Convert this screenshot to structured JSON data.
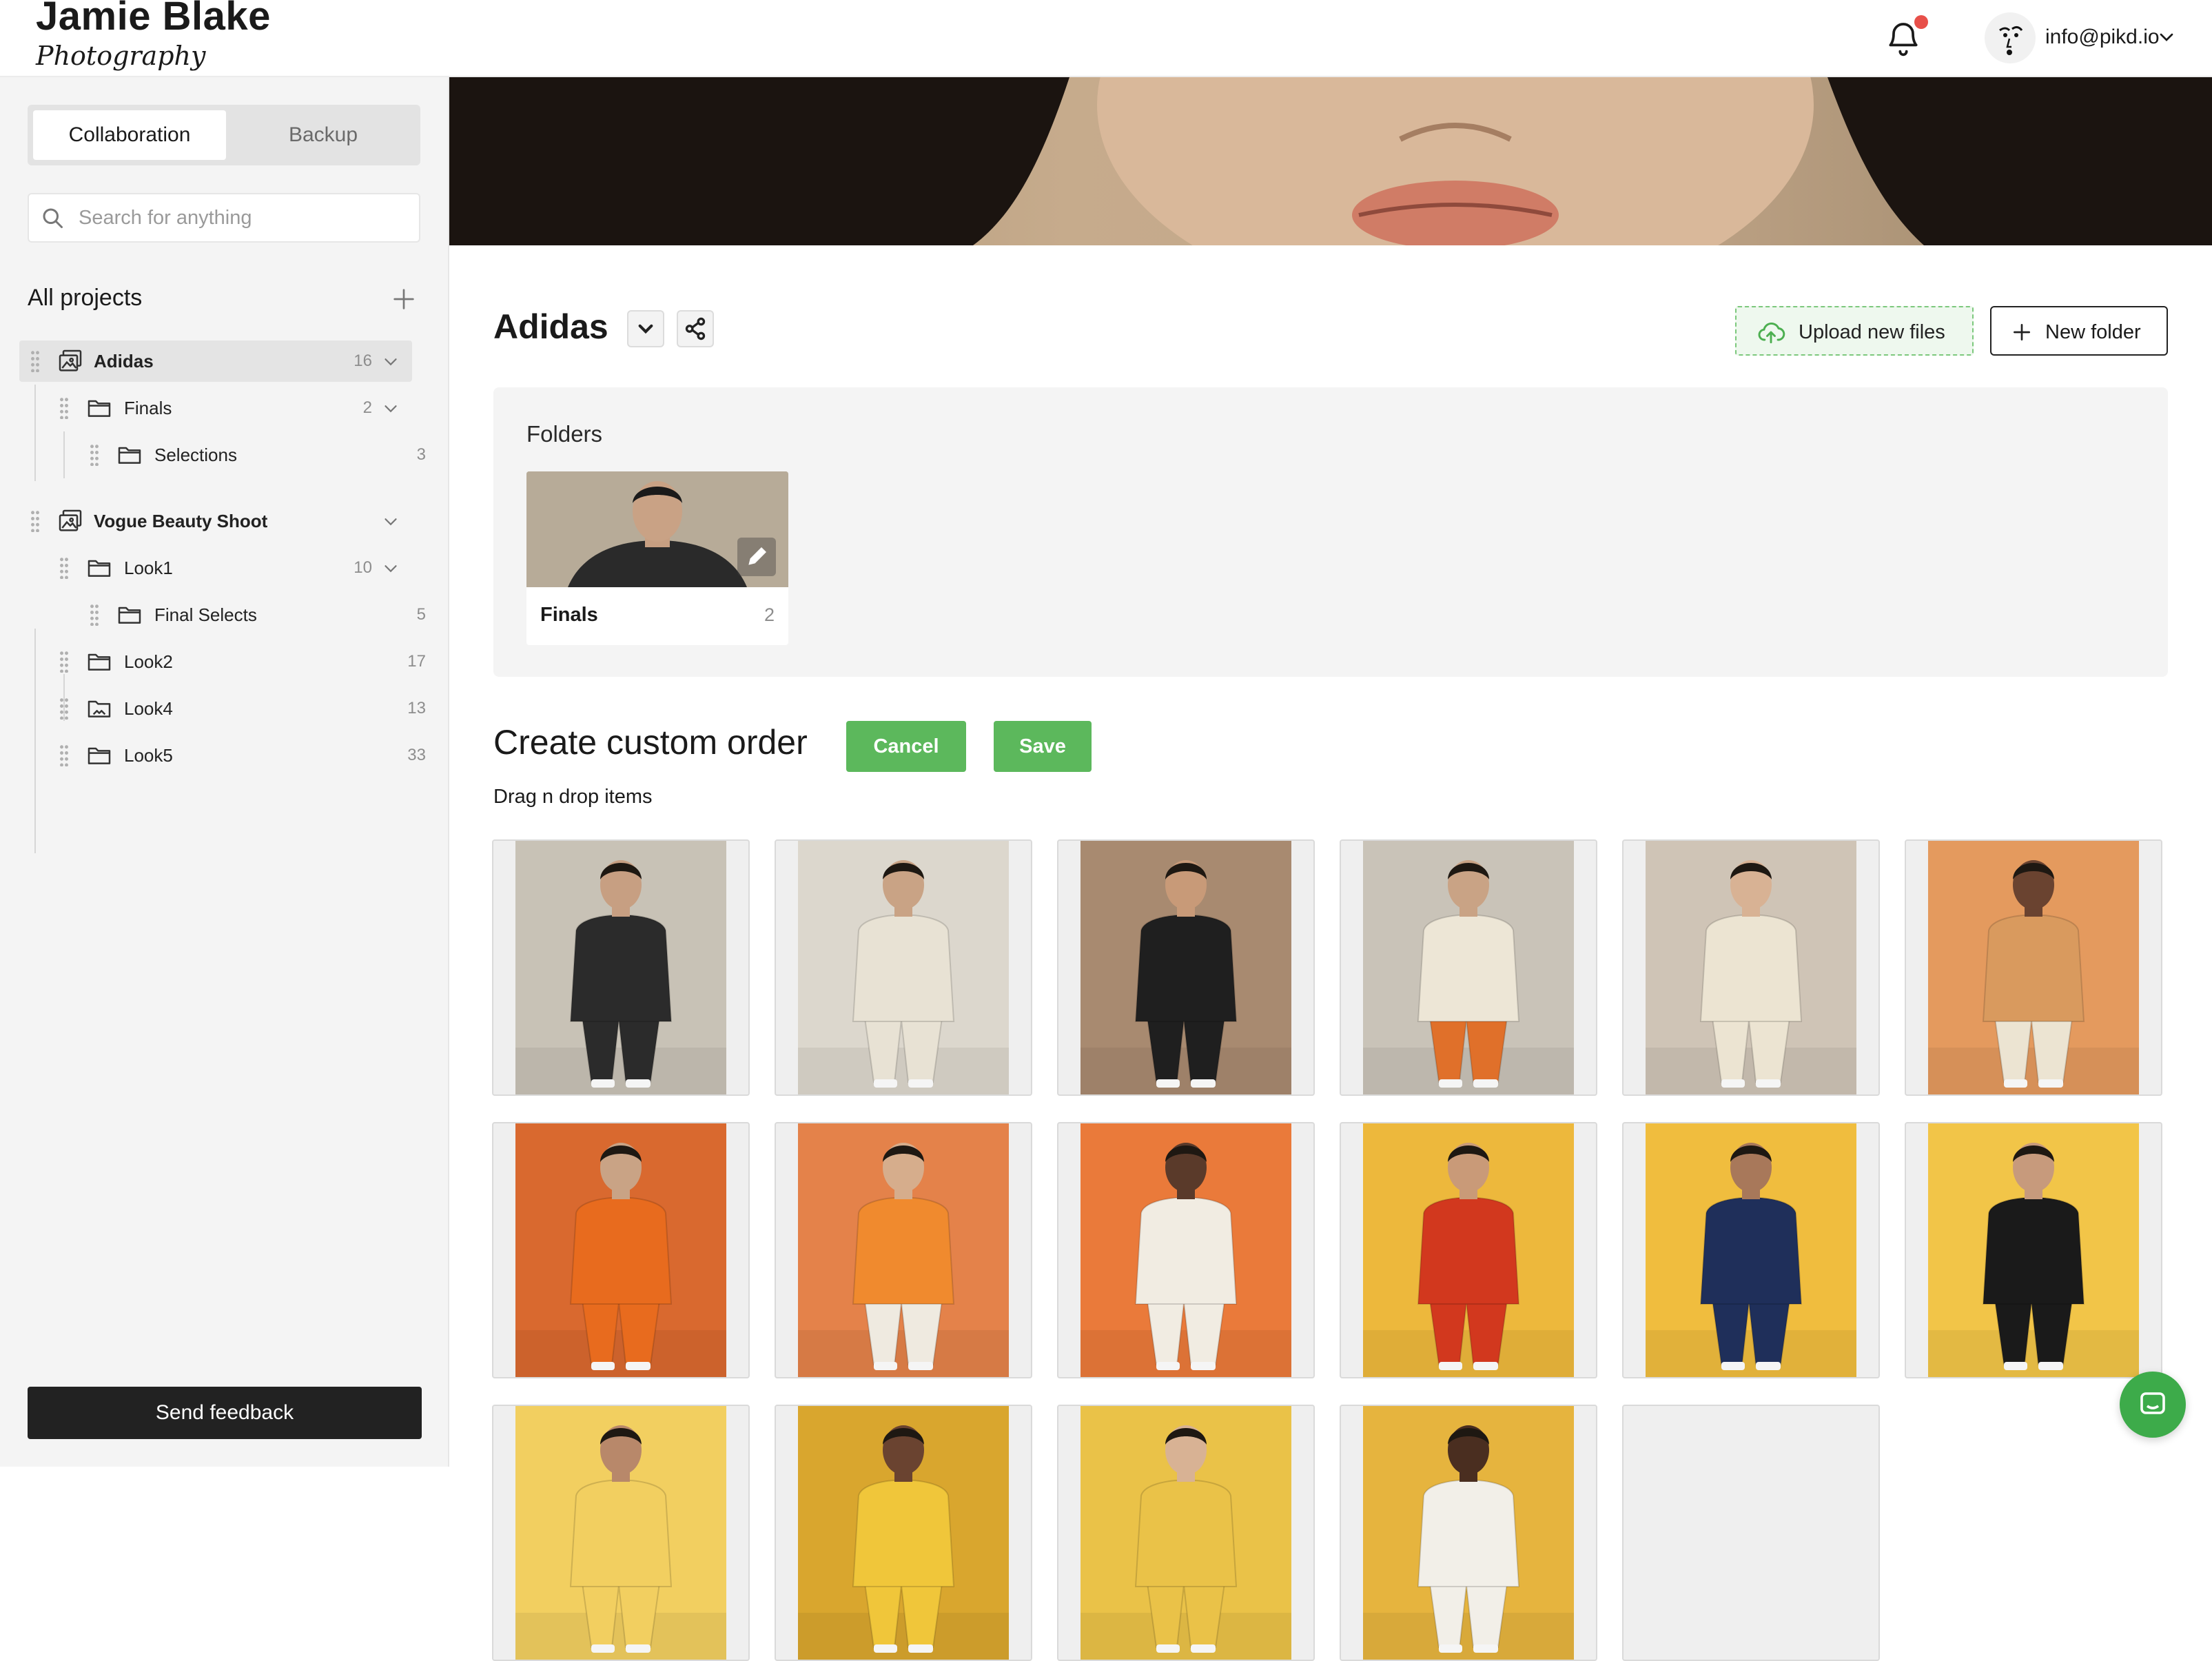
{
  "header": {
    "brand_name": "Jamie Blake",
    "brand_sub": "Photography",
    "account_email": "info@pikd.io",
    "notification_dot_color": "#e8504a"
  },
  "sidebar": {
    "tabs": [
      {
        "label": "Collaboration",
        "active": true
      },
      {
        "label": "Backup",
        "active": false
      }
    ],
    "search_placeholder": "Search for anything",
    "all_projects_label": "All projects",
    "tree": [
      {
        "label": "Adidas",
        "count": "16",
        "icon": "project-gallery-icon",
        "bold": true,
        "selected": true,
        "expanded": true
      },
      {
        "label": "Finals",
        "count": "2",
        "icon": "folder-icon",
        "expanded": true
      },
      {
        "label": "Selections",
        "count": "3",
        "icon": "folder-icon"
      },
      {
        "label": "Vogue Beauty Shoot",
        "count": "",
        "icon": "project-gallery-icon",
        "bold": true,
        "expanded": true
      },
      {
        "label": "Look1",
        "count": "10",
        "icon": "folder-icon",
        "expanded": true
      },
      {
        "label": "Final Selects",
        "count": "5",
        "icon": "folder-icon"
      },
      {
        "label": "Look2",
        "count": "17",
        "icon": "folder-icon"
      },
      {
        "label": "Look4",
        "count": "13",
        "icon": "folder-image-icon"
      },
      {
        "label": "Look5",
        "count": "33",
        "icon": "folder-icon"
      }
    ],
    "feedback_label": "Send feedback"
  },
  "main": {
    "project_title": "Adidas",
    "upload_label": "Upload new files",
    "new_folder_label": "New folder",
    "folders_title": "Folders",
    "folder_card": {
      "name": "Finals",
      "count": "2"
    },
    "order_title": "Create custom order",
    "cancel_label": "Cancel",
    "save_label": "Save",
    "order_subtitle": "Drag n drop items",
    "accent_green": "#5cb85c",
    "tiles": [
      {
        "bg": "#c8c2b6",
        "outfit": "#2b2b2b",
        "pants": "#2b2b2b",
        "skin": "#c79f82"
      },
      {
        "bg": "#dcd7cd",
        "outfit": "#e8e2d4",
        "pants": "#e8e2d4",
        "skin": "#c9a385"
      },
      {
        "bg": "#a88a70",
        "outfit": "#1f1f1f",
        "pants": "#1f1f1f",
        "skin": "#c89a78"
      },
      {
        "bg": "#c9c3b8",
        "outfit": "#ede6d6",
        "pants": "#e0702a",
        "skin": "#c9a385"
      },
      {
        "bg": "#cfc4b6",
        "outfit": "#ece4d2",
        "pants": "#ece4d2",
        "skin": "#d8b294"
      },
      {
        "bg": "#e49a5e",
        "outfit": "#d99a5e",
        "pants": "#ece4d2",
        "skin": "#6a4330"
      },
      {
        "bg": "#d9692f",
        "outfit": "#e86b1e",
        "pants": "#e86b1e",
        "skin": "#c9a385"
      },
      {
        "bg": "#e4824a",
        "outfit": "#f08a2e",
        "pants": "#efeae0",
        "skin": "#d6ad8c"
      },
      {
        "bg": "#ea7a3a",
        "outfit": "#f1ece2",
        "pants": "#f1ece2",
        "skin": "#5a3a2a"
      },
      {
        "bg": "#edb83c",
        "outfit": "#d2381e",
        "pants": "#d2381e",
        "skin": "#c99a78"
      },
      {
        "bg": "#f0bd3e",
        "outfit": "#1f2f5a",
        "pants": "#1f2f5a",
        "skin": "#a8785a"
      },
      {
        "bg": "#f2c548",
        "outfit": "#1a1a1a",
        "pants": "#1a1a1a",
        "skin": "#c79a7c"
      },
      {
        "bg": "#f2cf60",
        "outfit": "#f2cf60",
        "pants": "#f2cf60",
        "skin": "#b8886a"
      },
      {
        "bg": "#d9a62e",
        "outfit": "#f0c63a",
        "pants": "#f0c63a",
        "skin": "#6a4330"
      },
      {
        "bg": "#eac248",
        "outfit": "#eac248",
        "pants": "#eac248",
        "skin": "#d8b294"
      },
      {
        "bg": "#e6b43e",
        "outfit": "#f2efe8",
        "pants": "#f2efe8",
        "skin": "#4a2e20"
      },
      {
        "bg": "#efefef",
        "outfit": "",
        "pants": "",
        "skin": ""
      }
    ]
  }
}
